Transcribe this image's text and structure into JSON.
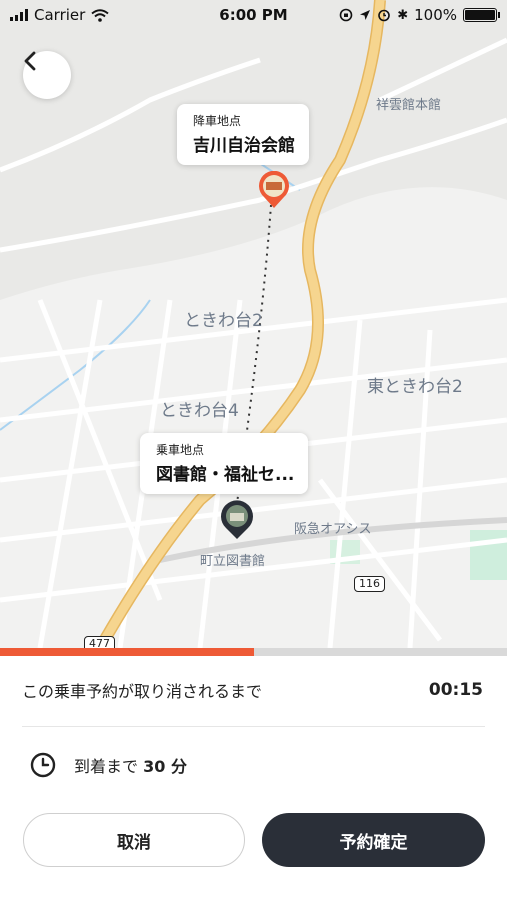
{
  "status_bar": {
    "carrier": "Carrier",
    "time": "6:00 PM",
    "battery": "100%"
  },
  "map": {
    "labels": {
      "area_tokiwadai2": "ときわ台2",
      "area_tokiwadai4": "ときわ台4",
      "area_higashi_tokiwadai2": "東ときわ台2",
      "poi_shounkan": "祥雲館本館",
      "poi_hankyu_oasis": "阪急オアシス",
      "poi_library": "町立図書館",
      "road_116": "116",
      "road_477": "477"
    },
    "dropoff": {
      "caption": "降車地点",
      "name": "吉川自治会館"
    },
    "pickup": {
      "caption": "乗車地点",
      "name": "図書館・福祉セ..."
    }
  },
  "countdown": {
    "label": "この乗車予約が取り消されるまで",
    "timer": "00:15",
    "progress_fraction": 0.5
  },
  "arrival": {
    "prefix": "到着まで",
    "value": "30 分"
  },
  "buttons": {
    "cancel": "取消",
    "confirm": "予約確定"
  },
  "colors": {
    "accent": "#ee5a36",
    "confirm_bg": "#2a2f38",
    "main_road": "#f3cc7c"
  },
  "icons": {
    "back": "chevron-left-icon",
    "clock": "clock-icon"
  }
}
